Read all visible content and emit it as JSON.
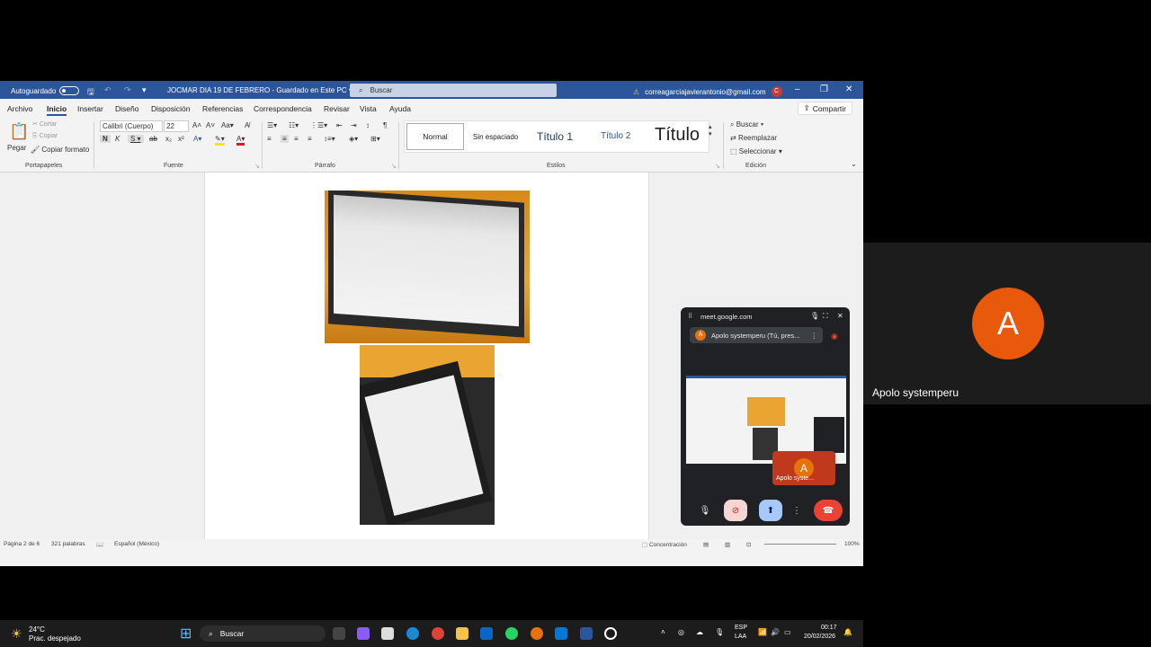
{
  "titlebar": {
    "autosave_label": "Autoguardado",
    "doc_title": "JOCMAR DIA 19 DE FEBRERO",
    "save_state": "Guardado en Este PC",
    "search_placeholder": "Buscar",
    "account_email": "correagarciajavierantonio@gmail.com",
    "avatar_letter": "C"
  },
  "menu": {
    "items": [
      "Archivo",
      "Inicio",
      "Insertar",
      "Diseño",
      "Disposición",
      "Referencias",
      "Correspondencia",
      "Revisar",
      "Vista",
      "Ayuda"
    ],
    "share_label": "Compartir"
  },
  "ribbon": {
    "clipboard": {
      "paste": "Pegar",
      "cut": "Cortar",
      "copy": "Copiar",
      "format_painter": "Copiar formato",
      "label": "Portapapeles"
    },
    "font": {
      "name": "Calibri (Cuerpo)",
      "size": "22",
      "label": "Fuente"
    },
    "paragraph": {
      "label": "Párrafo"
    },
    "styles": {
      "items": [
        "Normal",
        "Sin espaciado",
        "Título 1",
        "Título 2",
        "Título"
      ],
      "label": "Estilos"
    },
    "editing": {
      "find": "Buscar",
      "replace": "Reemplazar",
      "select": "Seleccionar",
      "label": "Edición"
    }
  },
  "statusbar": {
    "page": "Página 2 de 6",
    "words": "321 palabras",
    "language": "Español (México)",
    "focus": "Concentración",
    "zoom": "100%"
  },
  "taskbar": {
    "temp": "24°C",
    "weather": "Prac. despejado",
    "search": "Buscar",
    "lang1": "ESP",
    "lang2": "LAA",
    "time": "00:17",
    "date": "20/02/2026"
  },
  "meet_float": {
    "url": "meet.google.com",
    "presenting": "Apolo systemperu (Tú, pres...",
    "avatar_letter": "A",
    "self_label": "Apolo syste..."
  },
  "participant": {
    "letter": "A",
    "name": "Apolo systemperu",
    "color": "#e8590c"
  }
}
